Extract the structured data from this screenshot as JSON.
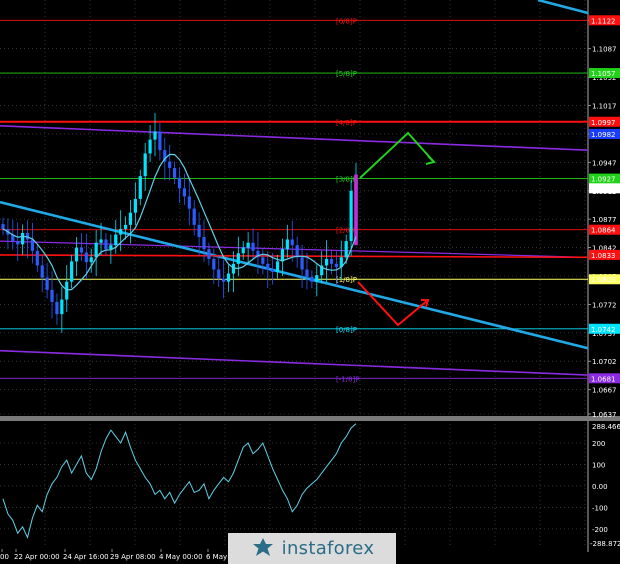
{
  "brand": {
    "name": "instaforex",
    "color": "#2b6d86"
  },
  "colors": {
    "background": "#000000",
    "bull": "#00e5ff",
    "bear": "#2a5cff",
    "ma": "#5fd1e8",
    "trend": "#21a9e6",
    "channel": "#8a2be2",
    "red_level": "#ff1010",
    "forecast_up": "#22d11a",
    "forecast_down": "#ff1010",
    "cci_line": "#5fd1e8"
  },
  "chart_data": [
    {
      "type": "candlestick",
      "ylim": [
        1.0637,
        1.1147
      ],
      "price_ticks": [
        "1.1122",
        "1.1087",
        "1.1052",
        "1.1017",
        "1.0982",
        "1.0947",
        "1.0912",
        "1.0877",
        "1.0842",
        "1.0807",
        "1.0772",
        "1.0737",
        "1.0702",
        "1.0667",
        "1.0637"
      ],
      "price_tags": [
        {
          "label": "1.1122",
          "color": "#ff1010",
          "price": 1.1122
        },
        {
          "label": "1.1057",
          "color": "#22d11a",
          "price": 1.1057
        },
        {
          "label": "1.0997",
          "color": "#ff1010",
          "price": 1.0997
        },
        {
          "label": "1.0982",
          "color": "#1a3cff",
          "price": 1.0982
        },
        {
          "label": "1.0927",
          "color": "#22d11a",
          "price": 1.0927
        },
        {
          "label": "1.0915",
          "color": "#ffffff",
          "price": 1.0915
        },
        {
          "label": "1.0864",
          "color": "#ff1010",
          "price": 1.0864
        },
        {
          "label": "1.0833",
          "color": "#ff1010",
          "price": 1.0833
        },
        {
          "label": "1.0803",
          "color": "#ffff66",
          "price": 1.0803
        },
        {
          "label": "1.0742",
          "color": "#00e5ff",
          "price": 1.0742
        },
        {
          "label": "1.0681",
          "color": "#8a2be2",
          "price": 1.0681
        }
      ],
      "murrey_levels": [
        {
          "label": "[6/8]P",
          "price": 1.1122,
          "color": "#ff1010"
        },
        {
          "label": "[5/8]P",
          "price": 1.1057,
          "color": "#22d11a"
        },
        {
          "label": "[4/8]P",
          "price": 1.0997,
          "color": "#ff1010"
        },
        {
          "label": "[3/8]P",
          "price": 1.0927,
          "color": "#22d11a"
        },
        {
          "label": "[2/8]P",
          "price": 1.0864,
          "color": "#ff1010"
        },
        {
          "label": "[1/8]P",
          "price": 1.0803,
          "color": "#ffff66"
        },
        {
          "label": "[0/8]P",
          "price": 1.0742,
          "color": "#00e5ff"
        },
        {
          "label": "[-1/8]P",
          "price": 1.0681,
          "color": "#8a2be2"
        }
      ],
      "moving_average_level": 1.0833,
      "x_labels": [
        "00",
        "22 Apr 00:00",
        "24 Apr 16:00",
        "29 Apr 08:00",
        "4 May 00:00",
        "6 May"
      ],
      "closes": [
        1.0865,
        1.0858,
        1.085,
        1.0846,
        1.086,
        1.0852,
        1.0838,
        1.082,
        1.0805,
        1.079,
        1.0775,
        1.076,
        1.0778,
        1.08,
        1.0825,
        1.0842,
        1.0836,
        1.0824,
        1.083,
        1.0848,
        1.0852,
        1.084,
        1.0845,
        1.0858,
        1.0865,
        1.087,
        1.0885,
        1.0902,
        1.093,
        1.0958,
        1.0975,
        1.0985,
        1.0962,
        1.0948,
        1.094,
        1.0928,
        1.0915,
        1.0905,
        1.089,
        1.087,
        1.0855,
        1.084,
        1.0828,
        1.0815,
        1.0804,
        1.08,
        1.081,
        1.0822,
        1.0835,
        1.0842,
        1.0848,
        1.0838,
        1.083,
        1.0822,
        1.0815,
        1.0812,
        1.0825,
        1.084,
        1.0852,
        1.0845,
        1.083,
        1.0815,
        1.0806,
        1.08,
        1.0808,
        1.082,
        1.0828,
        1.0822,
        1.0818,
        1.083,
        1.085,
        1.0912,
        1.0928
      ]
    },
    {
      "type": "line",
      "ylim": [
        -288.8727,
        288.4663
      ],
      "top_label": "288.4663",
      "bottom_label": "-288.8727",
      "y_ticks": [
        "200",
        "100",
        "0.00",
        "-100",
        "-200"
      ],
      "tick_values": [
        200,
        100,
        0,
        -100,
        -200
      ],
      "values": [
        -60,
        -130,
        -160,
        -220,
        -190,
        -240,
        -150,
        -90,
        -120,
        -40,
        10,
        40,
        90,
        120,
        60,
        100,
        140,
        60,
        30,
        80,
        160,
        220,
        260,
        230,
        200,
        250,
        180,
        120,
        80,
        40,
        10,
        -40,
        -20,
        -60,
        -30,
        -80,
        -40,
        -10,
        20,
        -30,
        -20,
        10,
        -60,
        -20,
        10,
        40,
        20,
        60,
        120,
        180,
        200,
        150,
        170,
        200,
        140,
        80,
        30,
        -20,
        -60,
        -120,
        -90,
        -40,
        -10,
        10,
        30,
        60,
        90,
        120,
        150,
        200,
        230,
        270,
        290
      ]
    }
  ]
}
